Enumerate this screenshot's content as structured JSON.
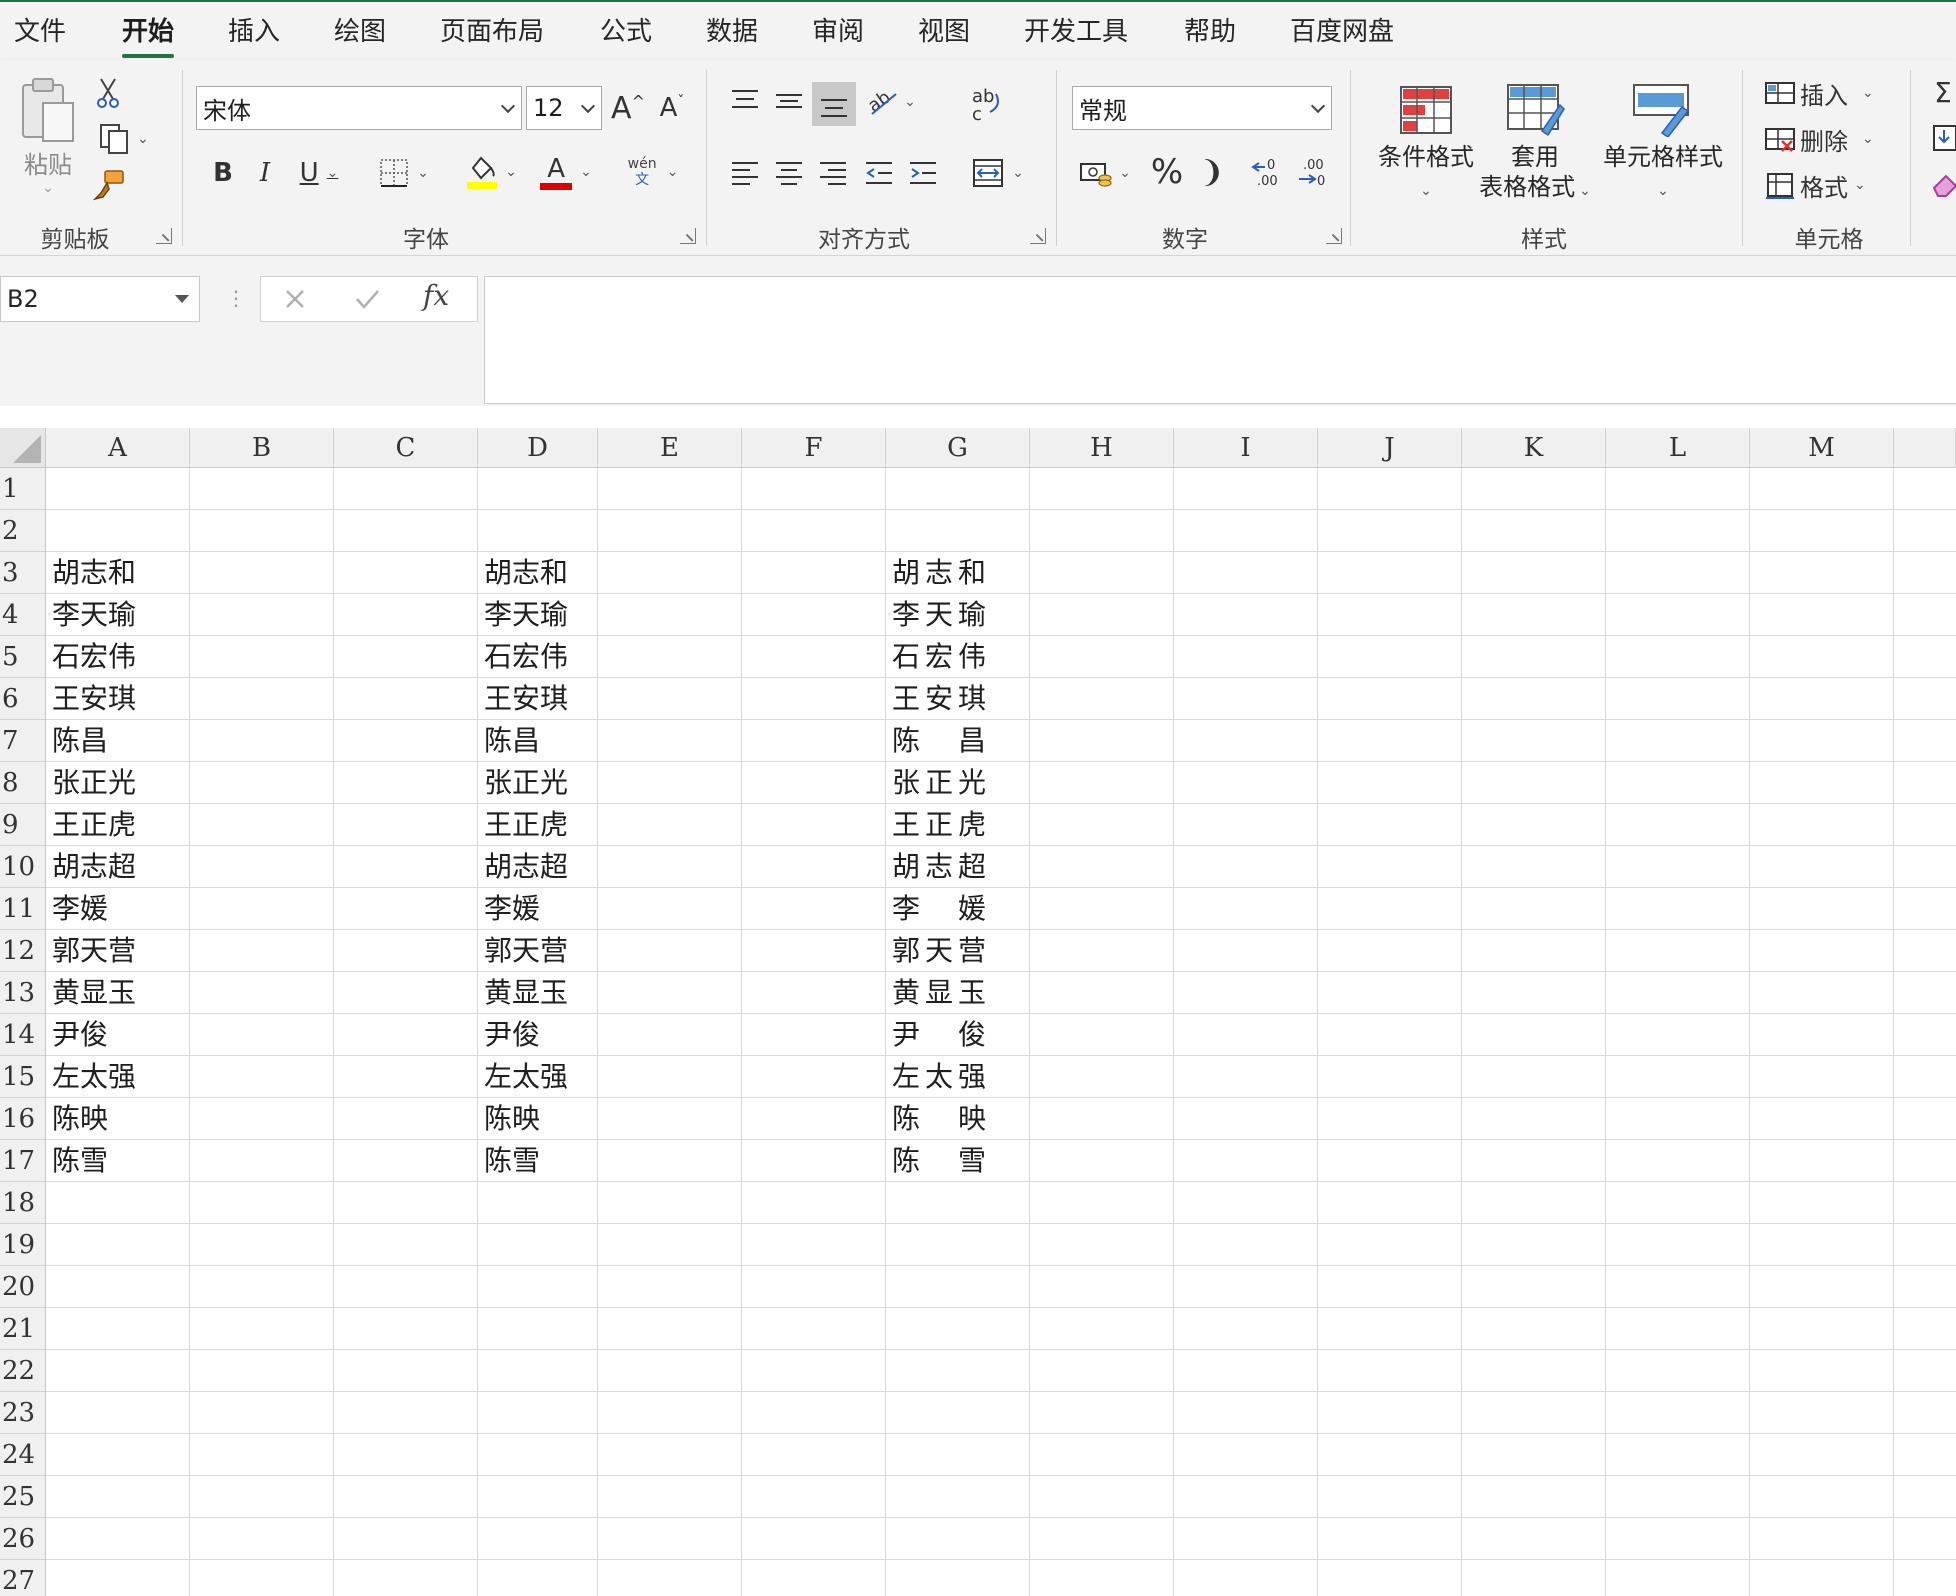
{
  "tabs": [
    {
      "label": "文件",
      "active": false
    },
    {
      "label": "开始",
      "active": true
    },
    {
      "label": "插入",
      "active": false
    },
    {
      "label": "绘图",
      "active": false
    },
    {
      "label": "页面布局",
      "active": false
    },
    {
      "label": "公式",
      "active": false
    },
    {
      "label": "数据",
      "active": false
    },
    {
      "label": "审阅",
      "active": false
    },
    {
      "label": "视图",
      "active": false
    },
    {
      "label": "开发工具",
      "active": false
    },
    {
      "label": "帮助",
      "active": false
    },
    {
      "label": "百度网盘",
      "active": false
    }
  ],
  "ribbon": {
    "clipboard": {
      "paste_label": "粘贴",
      "group_label": "剪贴板"
    },
    "font": {
      "font_name": "宋体",
      "font_size": "12",
      "group_label": "字体",
      "bold": "B",
      "italic": "I",
      "underline": "U",
      "grow": "A",
      "shrink": "A",
      "phonetic_top": "wén",
      "phonetic_bottom": "文",
      "font_color_glyph": "A"
    },
    "alignment": {
      "group_label": "对齐方式"
    },
    "number": {
      "format": "常规",
      "group_label": "数字",
      "percent": "%",
      "comma": "❩"
    },
    "styles": {
      "conditional": "条件格式",
      "table_line1": "套用",
      "table_line2": "表格格式",
      "cell_styles": "单元格样式",
      "group_label": "样式"
    },
    "cells": {
      "insert": "插入",
      "delete": "删除",
      "format": "格式",
      "group_label": "单元格"
    }
  },
  "formula_bar": {
    "name_box": "B2",
    "fx": "fx",
    "formula": ""
  },
  "columns": [
    "A",
    "B",
    "C",
    "D",
    "E",
    "F",
    "G",
    "H",
    "I",
    "J",
    "K",
    "L",
    "M"
  ],
  "rows": [
    "1",
    "2",
    "3",
    "4",
    "5",
    "6",
    "7",
    "8",
    "9",
    "10",
    "11",
    "12",
    "13",
    "14",
    "15",
    "16",
    "17",
    "18",
    "19",
    "20",
    "21",
    "22",
    "23",
    "24",
    "25",
    "26",
    "27"
  ],
  "names_a": [
    "胡志和",
    "李天瑜",
    "石宏伟",
    "王安琪",
    "陈昌",
    "张正光",
    "王正虎",
    "胡志超",
    "李媛",
    "郭天营",
    "黄显玉",
    "尹俊",
    "左太强",
    "陈映",
    "陈雪"
  ],
  "names_d": [
    "胡志和",
    "李天瑜",
    "石宏伟",
    "王安琪",
    "陈昌",
    "张正光",
    "王正虎",
    "胡志超",
    "李媛",
    "郭天营",
    "黄显玉",
    "尹俊",
    "左太强",
    "陈映",
    "陈雪"
  ],
  "names_g": [
    "胡志和",
    "李天瑜",
    "石宏伟",
    "王安琪",
    "陈昌",
    "张正光",
    "王正虎",
    "胡志超",
    "李媛",
    "郭天营",
    "黄显玉",
    "尹俊",
    "左太强",
    "陈映",
    "陈雪"
  ],
  "colors": {
    "accent": "#217346",
    "highlight": "#ffff00",
    "font_color": "#e00000"
  }
}
